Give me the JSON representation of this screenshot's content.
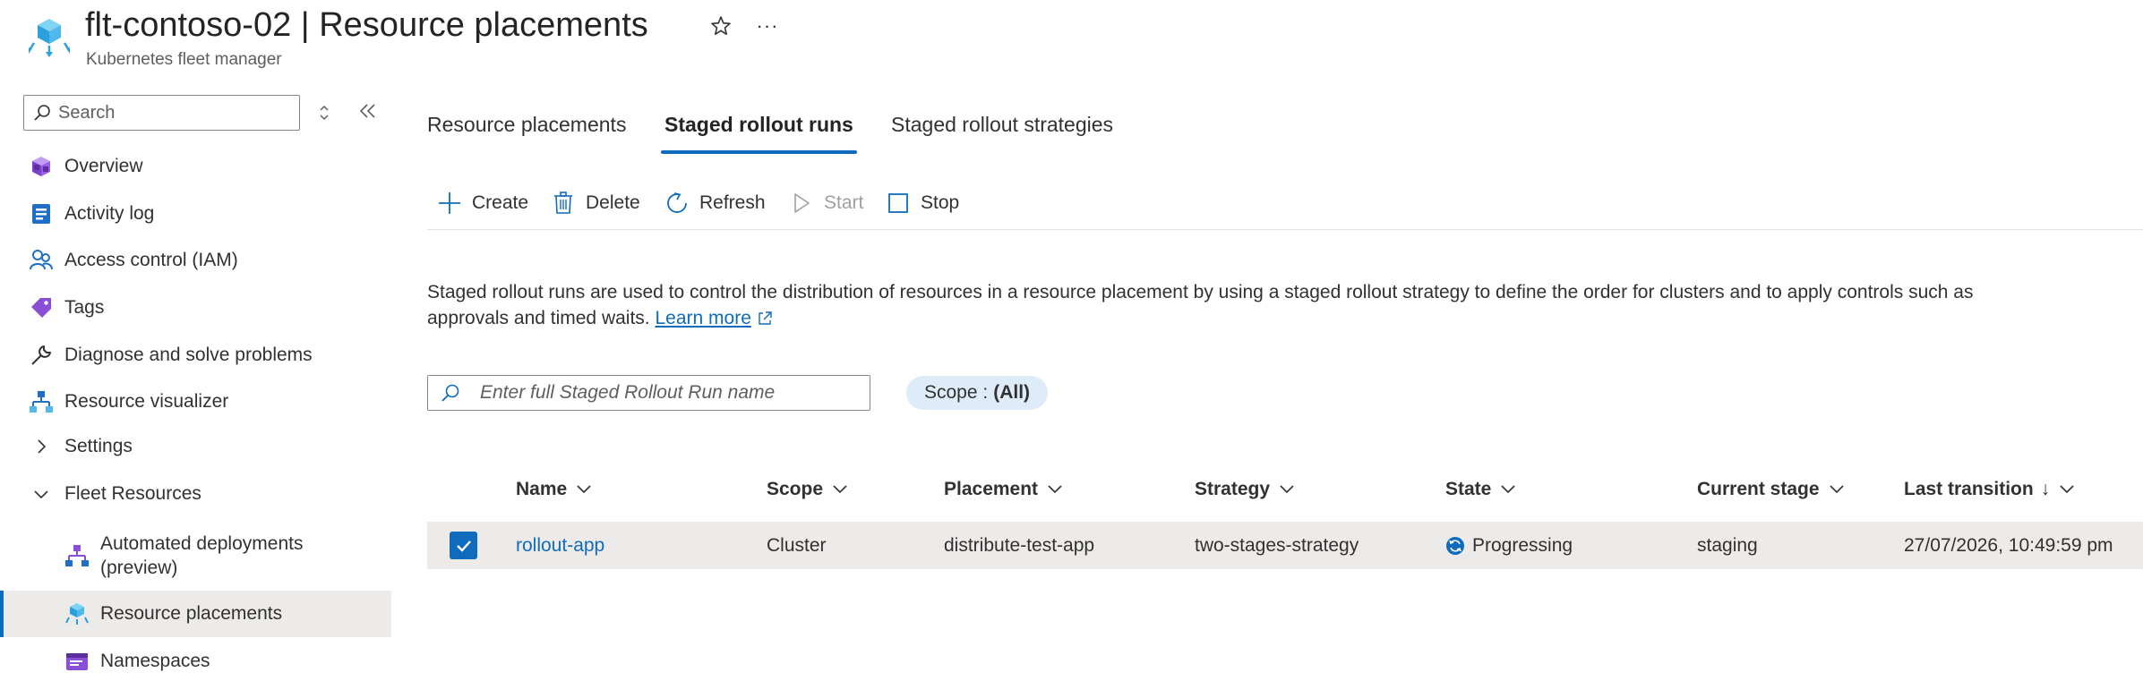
{
  "header": {
    "resource_name": "flt-contoso-02",
    "separator": "|",
    "page_name": "Resource placements",
    "subtitle": "Kubernetes fleet manager",
    "more_label": "···"
  },
  "sidebar": {
    "search_placeholder": "Search",
    "items": [
      {
        "label": "Overview",
        "icon": "overview-icon"
      },
      {
        "label": "Activity log",
        "icon": "activity-log-icon"
      },
      {
        "label": "Access control (IAM)",
        "icon": "people-icon"
      },
      {
        "label": "Tags",
        "icon": "tag-icon"
      },
      {
        "label": "Diagnose and solve problems",
        "icon": "wrench-icon"
      },
      {
        "label": "Resource visualizer",
        "icon": "visualizer-icon"
      },
      {
        "label": "Settings",
        "icon": "chevron-right-icon"
      },
      {
        "label": "Fleet Resources",
        "icon": "chevron-down-icon"
      },
      {
        "label": "Automated deployments (preview)",
        "icon": "deployments-icon"
      },
      {
        "label": "Resource placements",
        "icon": "placement-icon",
        "active": true
      },
      {
        "label": "Namespaces",
        "icon": "namespaces-icon"
      }
    ]
  },
  "tabs": [
    {
      "label": "Resource placements"
    },
    {
      "label": "Staged rollout runs",
      "active": true
    },
    {
      "label": "Staged rollout strategies"
    }
  ],
  "toolbar": {
    "create": "Create",
    "delete": "Delete",
    "refresh": "Refresh",
    "start": "Start",
    "stop": "Stop"
  },
  "description": {
    "text": "Staged rollout runs are used to control the distribution of resources in a resource placement by using a staged rollout strategy to define the order for clusters and to apply controls such as approvals and timed waits.",
    "link": "Learn more"
  },
  "filter": {
    "placeholder": "Enter full Staged Rollout Run name",
    "scope_label": "Scope :",
    "scope_value": "(All)"
  },
  "table": {
    "columns": [
      "Name",
      "Scope",
      "Placement",
      "Strategy",
      "State",
      "Current stage",
      "Last transition"
    ],
    "sort_arrow": "↓",
    "rows": [
      {
        "name": "rollout-app",
        "scope": "Cluster",
        "placement": "distribute-test-app",
        "strategy": "two-stages-strategy",
        "state": "Progressing",
        "current_stage": "staging",
        "last_transition": "27/07/2026, 10:49:59 pm"
      }
    ]
  },
  "colors": {
    "accent": "#0f6cbd",
    "selected_row": "#edebe9",
    "scope_pill": "#deecf9"
  }
}
